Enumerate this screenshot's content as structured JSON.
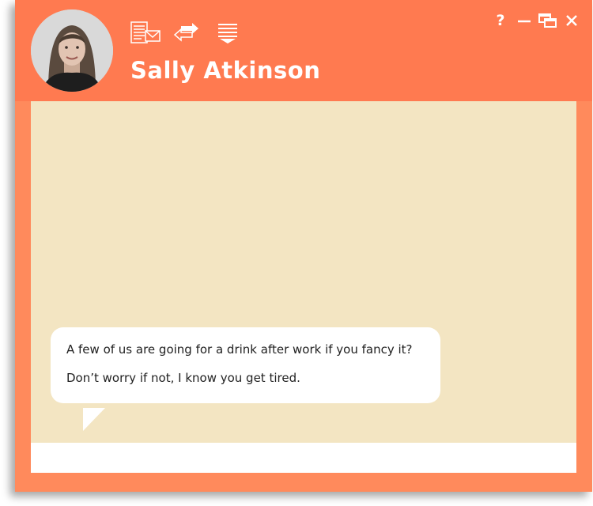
{
  "contact": {
    "name": "Sally Atkinson"
  },
  "toolbar": {
    "icons": [
      "contact-card-icon",
      "swap-arrows-icon",
      "menu-dropdown-icon"
    ]
  },
  "window_controls": {
    "help": "?",
    "minimize": "–",
    "restore": "⧉",
    "close": "✕"
  },
  "messages": [
    {
      "lines": [
        "A few of us are going for a drink after work if you fancy it?",
        "Don’t worry if not, I know you get tired."
      ]
    }
  ],
  "composer": {
    "value": "",
    "placeholder": ""
  },
  "colors": {
    "header": "#ff7a50",
    "frame": "#ff8a5c",
    "chat_background": "#f3e5c2",
    "bubble": "#ffffff",
    "text_light": "#ffffff"
  }
}
